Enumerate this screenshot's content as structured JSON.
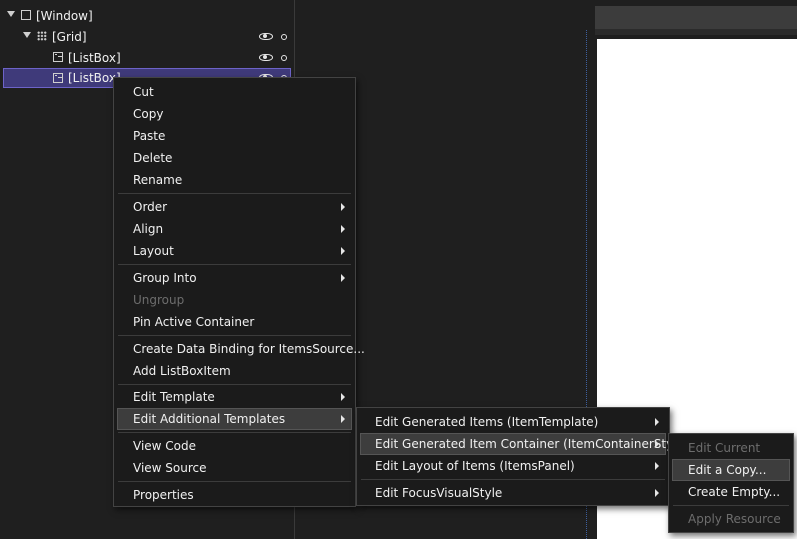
{
  "tree": {
    "items": [
      {
        "label": "[Window]",
        "icon": "window-icon"
      },
      {
        "label": "[Grid]",
        "icon": "grid-icon"
      },
      {
        "label": "[ListBox]",
        "icon": "listbox-icon"
      },
      {
        "label": "[ListBox]",
        "icon": "listbox-icon",
        "selected": true
      }
    ]
  },
  "context_menu": {
    "cut": "Cut",
    "copy": "Copy",
    "paste": "Paste",
    "delete": "Delete",
    "rename": "Rename",
    "order": "Order",
    "align": "Align",
    "layout": "Layout",
    "group_into": "Group Into",
    "ungroup": "Ungroup",
    "pin_active_container": "Pin Active Container",
    "create_data_binding": "Create Data Binding for ItemsSource...",
    "add_listboxitem": "Add ListBoxItem",
    "edit_template": "Edit Template",
    "edit_additional_templates": "Edit Additional Templates",
    "view_code": "View Code",
    "view_source": "View Source",
    "properties": "Properties"
  },
  "additional_templates_menu": {
    "edit_generated_items": "Edit Generated Items (ItemTemplate)",
    "edit_generated_item_container": "Edit Generated Item Container (ItemContainerStyle)",
    "edit_layout_of_items": "Edit Layout of Items (ItemsPanel)",
    "edit_focus_visual_style": "Edit FocusVisualStyle"
  },
  "item_container_style_menu": {
    "edit_current": "Edit Current",
    "edit_a_copy": "Edit a Copy...",
    "create_empty": "Create Empty...",
    "apply_resource": "Apply Resource"
  },
  "colors": {
    "selection": "#3f3a7a",
    "menu_background": "#1b1b1b",
    "menu_highlight": "#3d3d3d",
    "disabled_text": "#6d6d6d"
  }
}
